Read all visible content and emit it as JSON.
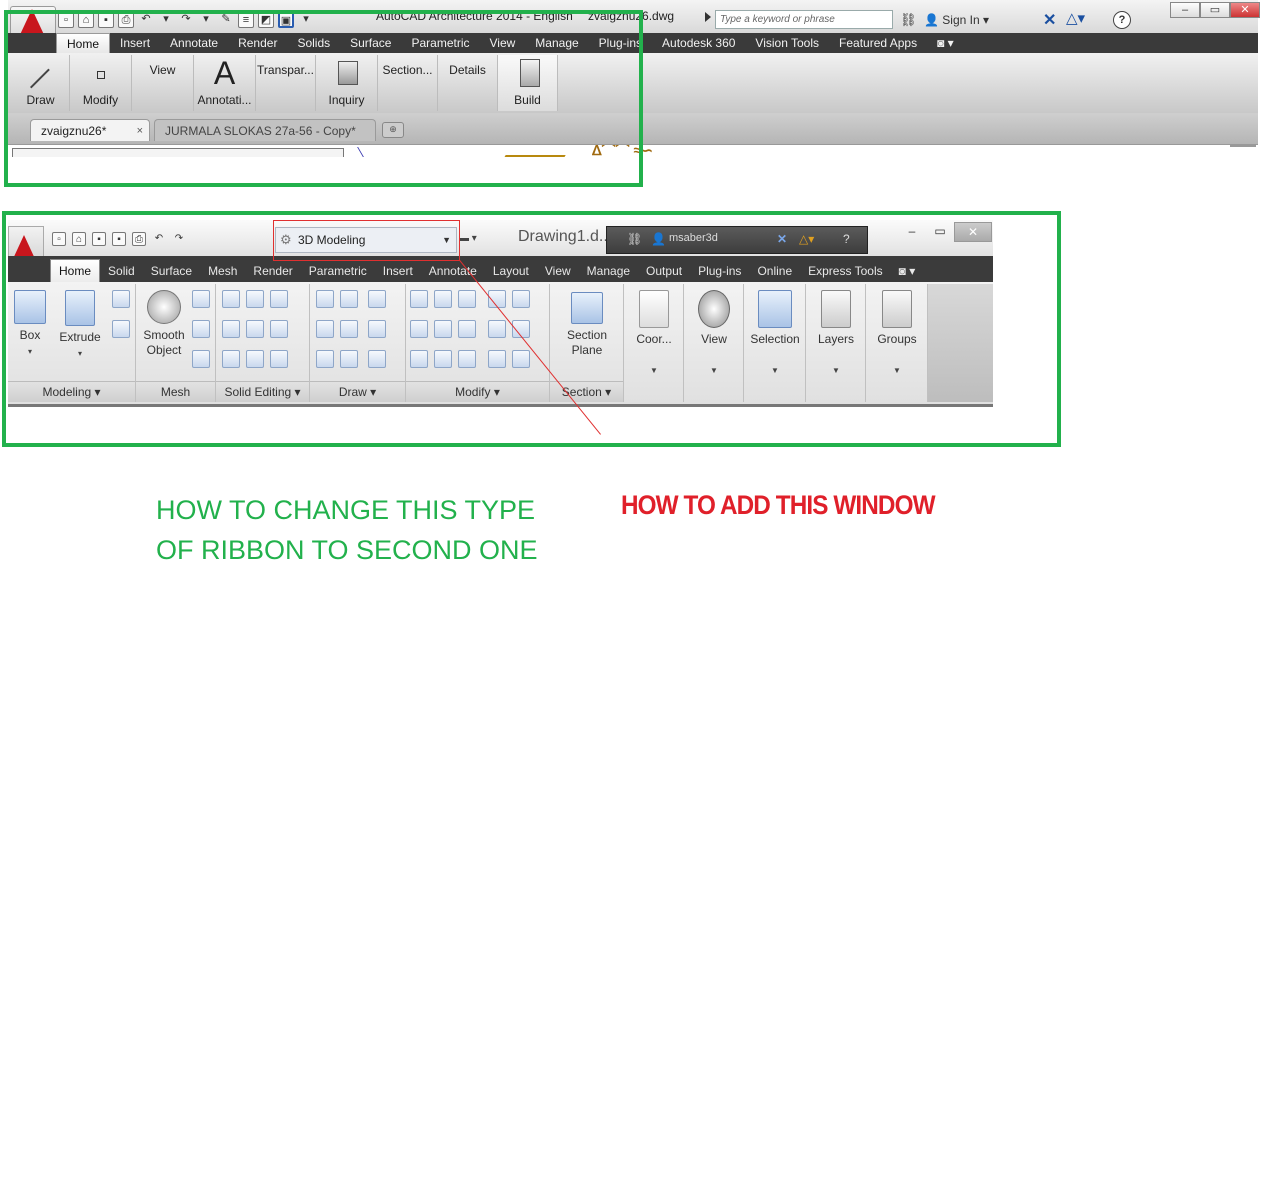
{
  "top_window": {
    "title": "AutoCAD Architecture 2014 - English",
    "file": "zvaigznu26.dwg",
    "search_placeholder": "Type a keyword or phrase",
    "sign_in": "Sign In",
    "help": "?",
    "app_menu_sub": "A",
    "tabs": [
      "Home",
      "Insert",
      "Annotate",
      "Render",
      "Solids",
      "Surface",
      "Parametric",
      "View",
      "Manage",
      "Plug-ins",
      "Autodesk 360",
      "Vision Tools",
      "Featured Apps"
    ],
    "panels": {
      "draw": "Draw",
      "modify": "Modify",
      "view": "View",
      "annotation": "Annotati...",
      "transparency": "Transpar...",
      "inquiry": "Inquiry",
      "section": "Section...",
      "details": "Details",
      "build": "Build"
    },
    "doc_tabs": [
      "zvaigznu26*",
      "JURMALA SLOKAS 27a-56 - Copy*"
    ],
    "close": "×"
  },
  "second_window": {
    "workspace": "3D Modeling",
    "title": "Drawing1.d...",
    "username": "msaber3d",
    "tabs": [
      "Home",
      "Solid",
      "Surface",
      "Mesh",
      "Render",
      "Parametric",
      "Insert",
      "Annotate",
      "Layout",
      "View",
      "Manage",
      "Output",
      "Plug-ins",
      "Online",
      "Express Tools"
    ],
    "buttons": {
      "box": "Box",
      "extrude": "Extrude",
      "smooth_object": "Smooth Object",
      "section_plane": "Section Plane",
      "coordinates": "Coor...",
      "view": "View",
      "selection": "Selection",
      "layers": "Layers",
      "groups": "Groups"
    },
    "panel_titles": {
      "modeling": "Modeling ▾",
      "mesh": "Mesh",
      "solid_editing": "Solid Editing ▾",
      "draw": "Draw ▾",
      "modify": "Modify ▾",
      "section": "Section ▾"
    }
  },
  "annotations": {
    "question_green": "HOW TO CHANGE THIS TYPE OF RIBBON TO SECOND ONE",
    "question_red": "HOW TO ADD THIS WINDOW",
    "green_color": "#22b14c",
    "red_color": "#e0202a"
  }
}
